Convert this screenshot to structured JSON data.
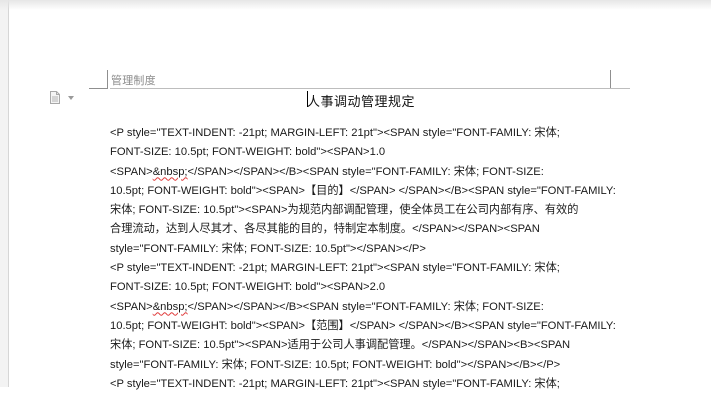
{
  "document": {
    "header_text": "管理制度",
    "title": "人事调动管理规定",
    "lines": [
      {
        "text": "<P style=\"TEXT-INDENT: -21pt; MARGIN-LEFT: 21pt\"><SPAN style=\"FONT-FAMILY: 宋体;"
      },
      {
        "text": "FONT-SIZE: 10.5pt; FONT-WEIGHT: bold\"><SPAN>1.0"
      },
      {
        "pre": "<SPAN>",
        "err": "&nbsp;",
        "post": "</SPAN></SPAN></B><SPAN style=\"FONT-FAMILY: 宋体; FONT-SIZE:"
      },
      {
        "text": "10.5pt; FONT-WEIGHT: bold\"><SPAN>【目的】</SPAN> </SPAN></B><SPAN style=\"FONT-FAMILY:"
      },
      {
        "text": "宋体; FONT-SIZE: 10.5pt\"><SPAN>为规范内部调配管理，使全体员工在公司内部有序、有效的"
      },
      {
        "text": "合理流动，达到人尽其才、各尽其能的目的，特制定本制度。</SPAN></SPAN><SPAN"
      },
      {
        "text": "style=\"FONT-FAMILY: 宋体; FONT-SIZE: 10.5pt\"></SPAN></P>"
      },
      {
        "text": "<P style=\"TEXT-INDENT: -21pt; MARGIN-LEFT: 21pt\"><SPAN style=\"FONT-FAMILY: 宋体;"
      },
      {
        "text": "FONT-SIZE: 10.5pt; FONT-WEIGHT: bold\"><SPAN>2.0"
      },
      {
        "pre": "<SPAN>",
        "err": "&nbsp;",
        "post": "</SPAN></SPAN></B><SPAN style=\"FONT-FAMILY: 宋体; FONT-SIZE:"
      },
      {
        "text": "10.5pt; FONT-WEIGHT: bold\"><SPAN>【范围】</SPAN> </SPAN></B><SPAN style=\"FONT-FAMILY:"
      },
      {
        "text": "宋体; FONT-SIZE: 10.5pt\"><SPAN>适用于公司人事调配管理。</SPAN></SPAN><B><SPAN"
      },
      {
        "text": "style=\"FONT-FAMILY: 宋体; FONT-SIZE: 10.5pt; FONT-WEIGHT: bold\"></SPAN></B></P>"
      },
      {
        "text": "<P style=\"TEXT-INDENT: -21pt; MARGIN-LEFT: 21pt\"><SPAN style=\"FONT-FAMILY: 宋体;"
      }
    ]
  }
}
